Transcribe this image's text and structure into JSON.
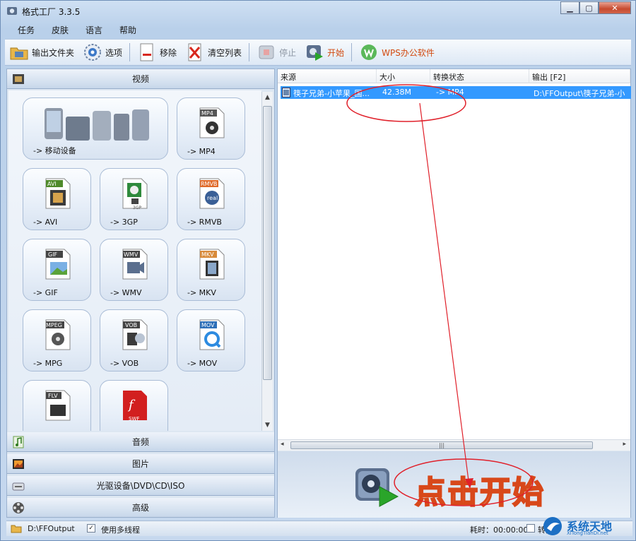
{
  "window": {
    "title": "格式工厂 3.3.5"
  },
  "menu": [
    "任务",
    "皮肤",
    "语言",
    "帮助"
  ],
  "toolbar": {
    "output_folder": "输出文件夹",
    "options": "选项",
    "remove": "移除",
    "clear_list": "清空列表",
    "stop": "停止",
    "start": "开始",
    "wps": "WPS办公软件"
  },
  "categories": {
    "video": "视频",
    "audio": "音频",
    "picture": "图片",
    "rom": "光驱设备\\DVD\\CD\\ISO",
    "advanced": "高级"
  },
  "video_tiles": [
    {
      "label": "-> 移动设备",
      "badge": ""
    },
    {
      "label": "-> MP4",
      "badge": "MP4"
    },
    {
      "label": "-> AVI",
      "badge": "AVI"
    },
    {
      "label": "-> 3GP",
      "badge": "3GP"
    },
    {
      "label": "-> RMVB",
      "badge": "RMVB"
    },
    {
      "label": "-> GIF",
      "badge": "GIF"
    },
    {
      "label": "-> WMV",
      "badge": "WMV"
    },
    {
      "label": "-> MKV",
      "badge": "MKV"
    },
    {
      "label": "-> MPG",
      "badge": "MPEG"
    },
    {
      "label": "-> VOB",
      "badge": "VOB"
    },
    {
      "label": "-> MOV",
      "badge": "MOV"
    },
    {
      "label": "",
      "badge": "FLV"
    },
    {
      "label": "",
      "badge": "SWF"
    }
  ],
  "task_list": {
    "columns": [
      "来源",
      "大小",
      "转换状态",
      "输出 [F2]"
    ],
    "rows": [
      {
        "source": "筷子兄弟-小苹果_国...",
        "size": "42.38M",
        "status": "-> MP4",
        "output": "D:\\FFOutput\\筷子兄弟-小"
      }
    ]
  },
  "start_banner": "点击开始",
  "statusbar": {
    "output_path": "D:\\FFOutput",
    "multithread_label": "使用多线程",
    "multithread_checked": "✓",
    "elapsed": "耗时：00:00:00",
    "after_convert": "转换"
  },
  "watermark": {
    "title": "系统天地",
    "sub": "XiTongTianDi.net"
  },
  "colors": {
    "highlight": "#3399ff",
    "annotation": "#e0202a",
    "accent": "#d24a10"
  }
}
